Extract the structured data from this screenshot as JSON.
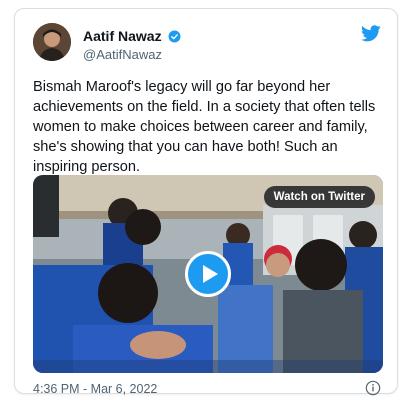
{
  "tweet": {
    "author_name": "Aatif Nawaz",
    "author_handle": "@AatifNawaz",
    "verified": true,
    "text": "Bismah Maroof's legacy will go far beyond her achievements on the field. In a society that often tells women to make choices between career and family, she's showing that you can have both! Such an inspiring person.",
    "media": {
      "watch_label": "Watch on Twitter"
    },
    "timestamp": "4:36 PM - Mar 6, 2022"
  },
  "icons": {
    "verified": "verified-badge-icon",
    "logo": "twitter-bird-icon",
    "play": "play-icon",
    "info": "info-icon"
  },
  "colors": {
    "accent": "#1d9bf0",
    "text": "#0f1419",
    "secondary": "#536471",
    "border": "#d9dee2"
  }
}
